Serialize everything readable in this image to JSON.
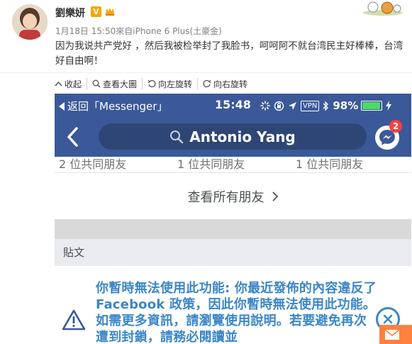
{
  "post": {
    "username": "劉樂妍",
    "verified_badge": "V",
    "meta": "1月18日 15:50來自iPhone 6 Plus(土豪金)",
    "text": "因为我说共产党好 ，然后我被检举封了我脸书，呵呵阿不就台湾民主好棒棒，台湾好自由啊！"
  },
  "toolbar": {
    "items": [
      {
        "label": "收起",
        "icon": "collapse-icon"
      },
      {
        "label": "查看大圖",
        "icon": "zoom-in-icon"
      },
      {
        "label": "向左旋转",
        "icon": "rotate-left-icon"
      },
      {
        "label": "向右旋转",
        "icon": "rotate-right-icon"
      }
    ]
  },
  "phone": {
    "status": {
      "back_label": "返回「Messenger」",
      "time": "15:48",
      "vpn": "VPN",
      "battery": "98%",
      "battery_level": 0.98
    },
    "search_text": "Antonio Yang",
    "messenger_badge": "2",
    "mutual_friends": [
      "2 位共同朋友",
      "1 位共同朋友",
      "1 位共同朋友"
    ],
    "see_all_label": "查看所有朋友",
    "posts_section_label": "貼文",
    "warning_text": "你暫時無法使用此功能: 你最近發佈的內容違反了 Facebook 政策，因此你暫時無法使用此功能。如需更多資訊，請瀏覽使用說明。若要避免再次遭到封鎖，請務必閱讀並"
  },
  "colors": {
    "facebook_blue": "#3b5998",
    "search_bar": "#2e4676",
    "warning_blue": "#3b86c8",
    "badge_red": "#fa3e3e",
    "battery_green": "#4cd964"
  }
}
